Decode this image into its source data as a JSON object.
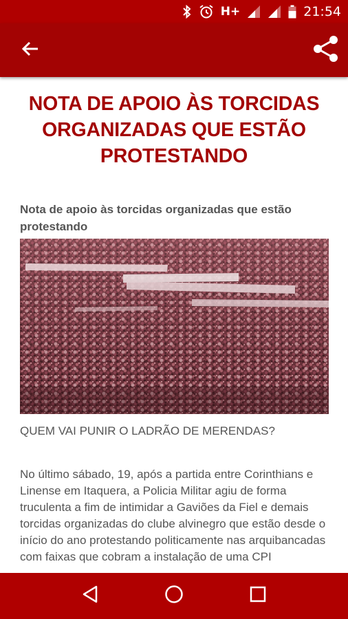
{
  "status_bar": {
    "network": "H+",
    "time": "21:54",
    "icons": [
      "bluetooth-icon",
      "alarm-icon",
      "signal-icon",
      "signal-icon",
      "battery-icon"
    ]
  },
  "app_bar": {
    "back_icon": "arrow-back-icon",
    "share_icon": "share-icon"
  },
  "article": {
    "headline": "NOTA DE APOIO ÀS TORCIDAS ORGANIZADAS QUE ESTÃO PROTESTANDO",
    "subtitle": "Nota de apoio às torcidas organizadas que estão protestando",
    "image_caption": "QUEM VAI PUNIR O LADRÃO DE MERENDAS?",
    "body": "No último sábado, 19, após a partida entre Corinthians e Linense em Itaquera, a Policia Militar agiu de forma truculenta a fim de intimidar a Gaviões da Fiel e demais torcidas organizadas do clube alvinegro que estão desde o início do ano protestando politicamente nas arquibancadas com faixas que cobram a instalação de uma CPI"
  },
  "nav_bar": {
    "icons": [
      "back-triangle-icon",
      "home-circle-icon",
      "recents-square-icon"
    ]
  },
  "colors": {
    "status_bar": "#b00000",
    "app_bar": "#a30303",
    "headline": "#a30303",
    "text": "#555555",
    "nav_bar": "#b00000"
  }
}
